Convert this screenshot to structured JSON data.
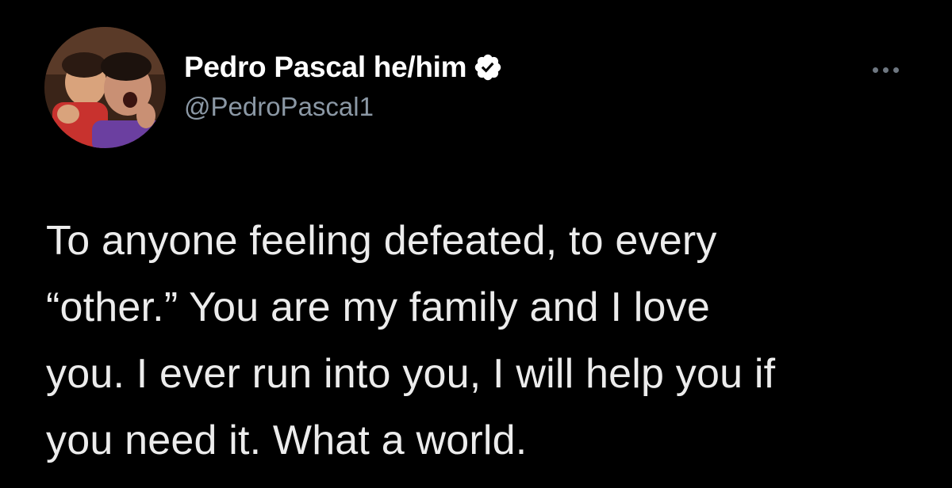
{
  "tweet": {
    "author": {
      "display_name": "Pedro Pascal he/him",
      "handle": "@PedroPascal1",
      "verified": true,
      "avatar_icon": "profile-photo",
      "verified_icon": "verified-badge-icon"
    },
    "more_icon": "more-options-icon",
    "text": "To anyone feeling defeated, to every\n“other.” You are my family and I love\nyou. I ever run into you, I will help you if\nyou need it. What a world."
  },
  "colors": {
    "background": "#000000",
    "name": "#ffffff",
    "handle": "#8b98a5",
    "body_text": "#ececec",
    "verified_badge": "#ffffff"
  }
}
